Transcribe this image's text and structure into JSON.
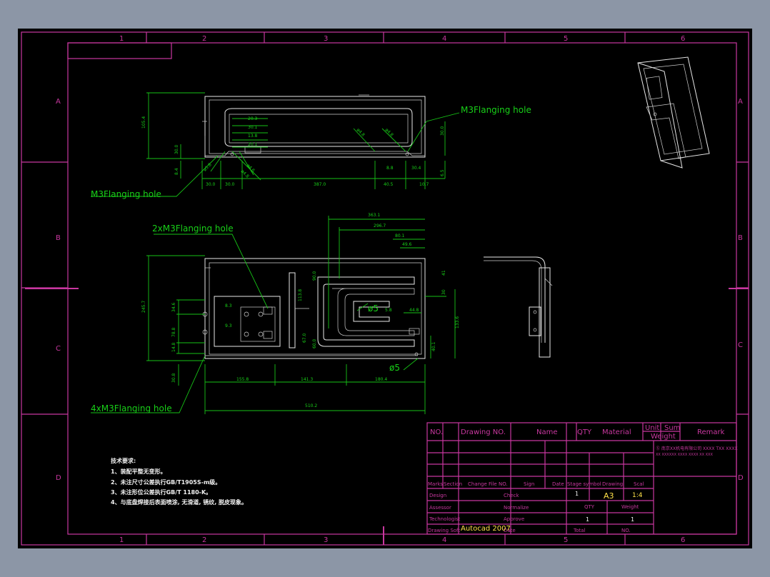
{
  "frame": {
    "columns": [
      "1",
      "2",
      "3",
      "4",
      "5",
      "6"
    ],
    "rows": [
      "A",
      "B",
      "C",
      "D"
    ]
  },
  "callouts": {
    "front_flange": "M3Flanging hole",
    "left_flange": "M3Flanging hole",
    "top_flange2": "2xM3Flanging hole",
    "bottom_flange4": "4xM3Flanging hole",
    "dia5_a": "ø5",
    "dia5_b": "ø5"
  },
  "dims_front": [
    "105.4",
    "30.0",
    "8.4",
    "30.0",
    "30.0",
    "387.0",
    "40.5",
    "10.7",
    "30.0",
    "6.5",
    "30.4",
    "8.8",
    "20.3",
    "30.1",
    "13.8",
    "20.1",
    "ø4.8",
    "ø4.6",
    "ø5.8",
    "ø4.8",
    "ø4.8"
  ],
  "dims_top": [
    "363.1",
    "296.7",
    "80.1",
    "49.6",
    "245.7",
    "34.6",
    "78.8",
    "14.8",
    "30.8",
    "155.8",
    "141.3",
    "180.4",
    "510.2",
    "5.8",
    "44.8",
    "133.6",
    "40.1",
    "30",
    "10",
    "41",
    "8.3",
    "9.3",
    "90.0",
    "67.0",
    "113.8",
    "60.0"
  ],
  "tech_notes": {
    "title": "技术要求:",
    "lines": [
      "1、装配平整无变形。",
      "2、未注尺寸公差执行GB/T1905S-m级。",
      "3、未注形位公差执行GB/T 1180-K。",
      "4、与底盘焊接后表面喷涂, 无滑道, 锈纹, 脱皮现象。"
    ]
  },
  "title_block": {
    "header": [
      "NO.",
      "Drawing NO.",
      "Name",
      "QTY",
      "Material",
      "Unit",
      "Sum",
      "Weight",
      "Remark"
    ],
    "company": "Ⓢ 南京XX机电有限公司  XXXX TXX XXXX",
    "company2": "XX XXXXXX XXXX XXXX XX XXX",
    "rows": {
      "marks": "Marks",
      "section": "Section",
      "change": "Change File NO.",
      "sign": "Sign",
      "date": "Date",
      "stage": "Stage symbol",
      "drawing": "Drawing",
      "scale": "Scal",
      "design": "Design",
      "check": "Check",
      "assessor": "Assessor",
      "normalize": "Normalize",
      "technologist": "Technologist",
      "approve": "Approve",
      "drawing_soft": "Drawing Soft",
      "date2": "Date",
      "qty": "QTY",
      "weight": "Weight",
      "total": "Total",
      "no": "NO.",
      "software": "Autocad 2007",
      "size": "A3",
      "scale_val": "1:4",
      "qty_val": "1",
      "weight_val": "1",
      "check_val": "1",
      "approve_val": "1"
    }
  },
  "colors": {
    "background": "#000000",
    "frame": "#c8379f",
    "dimension": "#16c216",
    "geometry": "#e8e8e8",
    "software_label": "#ffe14a"
  }
}
